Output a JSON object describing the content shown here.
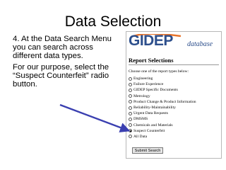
{
  "slide": {
    "title": "Data Selection",
    "paragraphs": [
      "4. At the Data Search Menu you can search across different data types.",
      "For our purpose, select the “Suspect Counterfeit” radio button."
    ]
  },
  "screenshot": {
    "logo": {
      "text": "GIDEP",
      "subtext": "database"
    },
    "heading": "Report Selections",
    "instruction": "Choose one of the report types below:",
    "options": [
      {
        "label": "Engineering",
        "checked": false
      },
      {
        "label": "Failure Experience",
        "checked": false
      },
      {
        "label": "GIDEP Specific Documents",
        "checked": false
      },
      {
        "label": "Metrology",
        "checked": false
      },
      {
        "label": "Product Change & Product Information",
        "checked": false
      },
      {
        "label": "Reliability-Maintainability",
        "checked": false
      },
      {
        "label": "Urgent Data Requests",
        "checked": false
      },
      {
        "label": "DMSMS",
        "checked": false
      },
      {
        "label": "Chemicals and Materials",
        "checked": false
      },
      {
        "label": "Suspect Counterfeit",
        "checked": true
      },
      {
        "label": "All Data",
        "checked": false
      }
    ],
    "submit_label": "Submit Search"
  },
  "colors": {
    "logo_blue": "#2d4f8c",
    "logo_swoosh": "#e8732a",
    "arrow": "#3a3fb0"
  }
}
